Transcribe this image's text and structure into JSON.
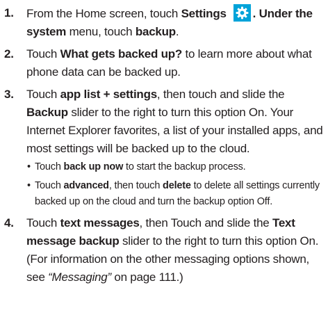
{
  "steps": [
    {
      "num": "1.",
      "parts": {
        "t1": "From the Home screen, touch ",
        "b1": "Settings",
        "t2": ". Under the ",
        "b2": "system",
        "t3": " menu, touch ",
        "b3": "backup",
        "t4": "."
      },
      "icon": "settings-gear-icon"
    },
    {
      "num": "2.",
      "parts": {
        "t1": "Touch ",
        "b1": "What gets backed up?",
        "t2": " to learn more about what phone data can be backed up."
      }
    },
    {
      "num": "3.",
      "parts": {
        "t1": "Touch ",
        "b1": "app list + settings",
        "t2": ", then touch and slide the ",
        "b2": "Backup",
        "t3": " slider to the right to turn this option On. Your Internet Explorer favorites, a list of your installed apps, and most settings will be backed up to the cloud."
      },
      "bullets": [
        {
          "dot": "•",
          "t1": "Touch ",
          "b1": "back up now",
          "t2": " to start the backup process."
        },
        {
          "dot": "•",
          "t1": "Touch ",
          "b1": "advanced",
          "t2": ", then touch ",
          "b2": "delete",
          "t3": " to delete all settings currently backed up on the cloud and turn the backup option Off."
        }
      ]
    },
    {
      "num": "4.",
      "parts": {
        "t1": "Touch ",
        "b1": "text messages",
        "t2": ", then Touch and slide the ",
        "b2": "Text message backup",
        "t3": " slider to the right to turn this option On. (For information on the other messaging options shown, see ",
        "i1": "“Messaging”",
        "t4": " on page 111.)"
      }
    }
  ],
  "colors": {
    "text": "#231f20",
    "settings_icon_bg": "#00a3d9",
    "settings_icon_fg": "#ffffff"
  }
}
